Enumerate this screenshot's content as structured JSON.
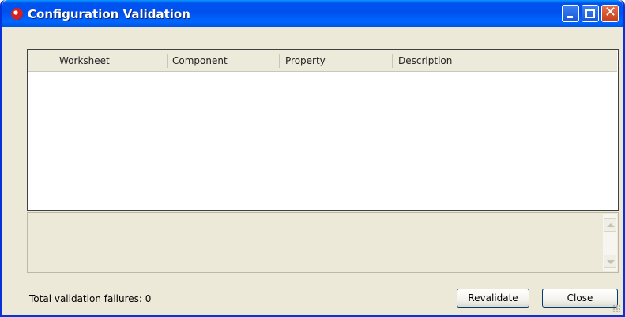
{
  "window": {
    "title": "Configuration Validation",
    "controls": [
      "minimize-icon",
      "maximize-icon",
      "close-icon"
    ]
  },
  "table": {
    "columns": [
      "Worksheet",
      "Component",
      "Property",
      "Description"
    ],
    "rows": []
  },
  "status": {
    "text": "Total validation failures: 0"
  },
  "buttons": {
    "revalidate_label": "Revalidate",
    "close_label": "Close"
  },
  "colors": {
    "titlebar": "#0054e3",
    "window_bg": "#ece9d8",
    "button_border": "#003c74"
  }
}
